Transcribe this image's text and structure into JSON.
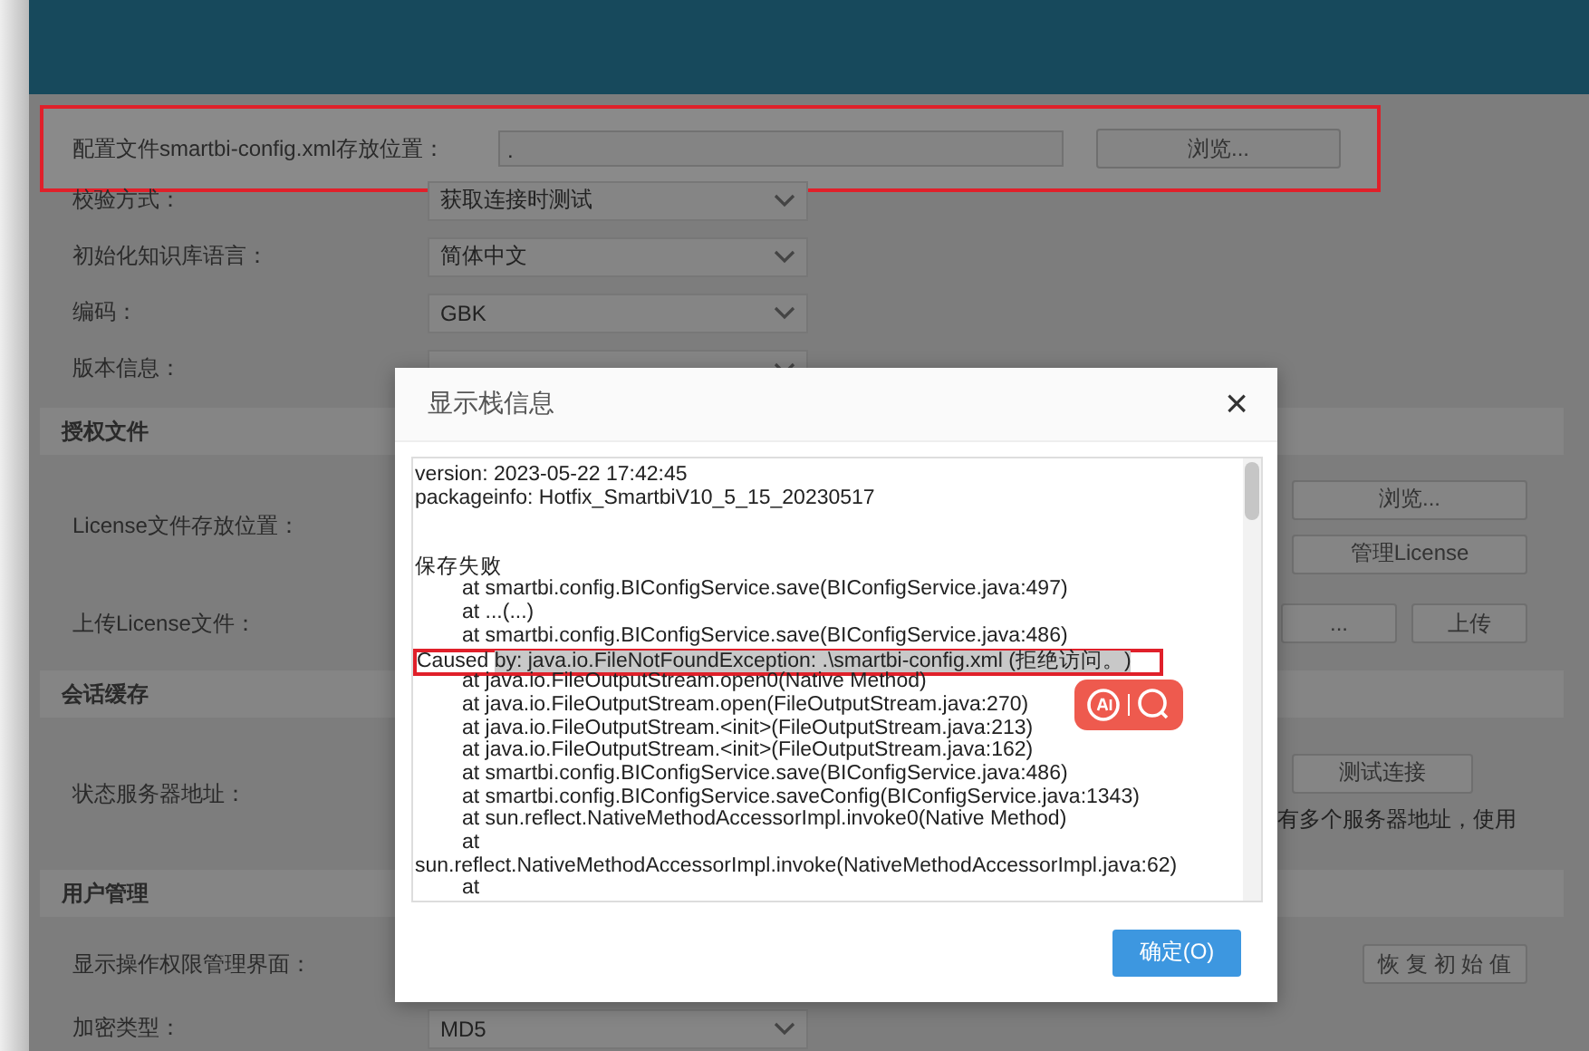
{
  "config_path": {
    "label": "配置文件smartbi-config.xml存放位置：",
    "value": ".",
    "button": "浏览...",
    "highlighted": true
  },
  "form_items": [
    {
      "kind": "select",
      "label": "校验方式：",
      "value": "获取连接时测试"
    },
    {
      "kind": "select",
      "label": "初始化知识库语言：",
      "value": "简体中文"
    },
    {
      "kind": "select",
      "label": "编码：",
      "value": "GBK"
    },
    {
      "kind": "select",
      "label": "版本信息："
    },
    {
      "kind": "section",
      "label": "授权文件"
    },
    {
      "kind": "stacked",
      "label": "License文件存放位置：",
      "buttons": [
        "浏览...",
        "管理License"
      ]
    },
    {
      "kind": "inline",
      "label": "上传License文件：",
      "buttons": [
        "...",
        "上传"
      ]
    },
    {
      "kind": "section",
      "label": "会话缓存"
    },
    {
      "kind": "note",
      "label": "状态服务器地址：",
      "buttons": [
        "测试连接"
      ],
      "note": "有多个服务器地址，使用"
    },
    {
      "kind": "section",
      "label": "用户管理"
    },
    {
      "kind": "inline",
      "label": "显示操作权限管理界面：",
      "buttons": [
        "恢 复 初 始 值"
      ]
    },
    {
      "kind": "select",
      "label": "加密类型：",
      "value": "MD5"
    }
  ],
  "dialog": {
    "title": "显示栈信息",
    "close": "×",
    "ok": "确定(O)",
    "lines": [
      {
        "kind": "plain",
        "text": "version:    2023-05-22 17:42:45"
      },
      {
        "kind": "plain",
        "text": "packageinfo:    Hotfix_SmartbiV10_5_15_20230517"
      },
      {
        "kind": "blank"
      },
      {
        "kind": "blank"
      },
      {
        "kind": "plain",
        "text": "保存失败"
      },
      {
        "kind": "frame",
        "text": "at smartbi.config.BIConfigService.save(BIConfigService.java:497)"
      },
      {
        "kind": "frame",
        "text": "at ...(...)"
      },
      {
        "kind": "frame",
        "text": "at smartbi.config.BIConfigService.save(BIConfigService.java:486)"
      },
      {
        "kind": "marked",
        "text": "Caused ",
        "selection": "by: java.io.FileNotFoundException: .\\smartbi-config.xml (拒绝访问。)"
      },
      {
        "kind": "frame",
        "text": "at java.io.FileOutputStream.open0(Native Method)"
      },
      {
        "kind": "frame",
        "text": "at java.io.FileOutputStream.open(FileOutputStream.java:270)"
      },
      {
        "kind": "frame",
        "text": "at java.io.FileOutputStream.<init>(FileOutputStream.java:213)"
      },
      {
        "kind": "frame",
        "text": "at java.io.FileOutputStream.<init>(FileOutputStream.java:162)"
      },
      {
        "kind": "frame",
        "text": "at smartbi.config.BIConfigService.save(BIConfigService.java:486)"
      },
      {
        "kind": "frame",
        "text": "at smartbi.config.BIConfigService.saveConfig(BIConfigService.java:1343)"
      },
      {
        "kind": "frame",
        "text": "at sun.reflect.NativeMethodAccessorImpl.invoke0(Native Method)"
      },
      {
        "kind": "frame",
        "text": "at"
      },
      {
        "kind": "plain",
        "text": "sun.reflect.NativeMethodAccessorImpl.invoke(NativeMethodAccessorImpl.java:62)"
      },
      {
        "kind": "frame",
        "text": "at"
      }
    ]
  }
}
